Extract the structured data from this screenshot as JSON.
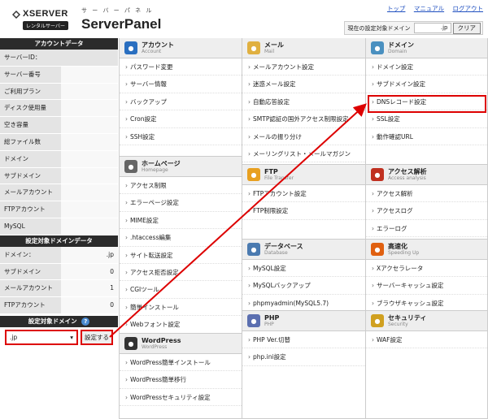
{
  "header": {
    "logo_text": "XSERVER",
    "logo_sub": "レンタルサーバー",
    "title_kana": "サ ー バ ー パ ネ ル",
    "title": "ServerPanel",
    "links": [
      "トップ",
      "マニュアル",
      "ログアウト"
    ],
    "domain_label": "現在の設定対象ドメイン",
    "domain_value": ".jp",
    "clear_label": "クリア"
  },
  "left": {
    "account_head": "アカウントデータ",
    "server_id": "サーバーID：",
    "account_rows": [
      "サーバー番号",
      "ご利用プラン",
      "ディスク使用量",
      "空き容量",
      "総ファイル数",
      "ドメイン",
      "サブドメイン",
      "メールアカウント",
      "FTPアカウント",
      "MySQL"
    ],
    "domain_head": "設定対象ドメインデータ",
    "domain_rows": [
      {
        "k": "ドメイン：",
        "v": ".jp"
      },
      {
        "k": "サブドメイン",
        "v": "0"
      },
      {
        "k": "メールアカウント",
        "v": "1"
      },
      {
        "k": "FTPアカウント",
        "v": "0"
      }
    ],
    "select_head": "設定対象ドメイン",
    "select_value": ".jp",
    "set_button": "設定する"
  },
  "columns": [
    [
      {
        "title": "アカウント",
        "sub": "Account",
        "color": "#2a6fc0",
        "icon": "person-icon",
        "items": [
          "パスワード変更",
          "サーバー情報",
          "バックアップ",
          "Cron設定",
          "SSH設定"
        ],
        "h": 146
      },
      {
        "title": "ホームページ",
        "sub": "Homepage",
        "color": "#666",
        "icon": "home-icon",
        "items": [
          "アクセス制限",
          "エラーページ設定",
          "MIME設定",
          ".htaccess編集",
          "サイト転送設定",
          "アクセス拒否設定",
          "CGIツール",
          "簡単インストール",
          "Webフォント設定"
        ],
        "h": 218
      },
      {
        "title": "WordPress",
        "sub": "WordPress",
        "color": "#333",
        "icon": "wordpress-icon",
        "items": [
          "WordPress簡単インストール",
          "WordPress簡単移行",
          "WordPressセキュリティ設定"
        ],
        "h": 105
      }
    ],
    [
      {
        "title": "メール",
        "sub": "Mail",
        "color": "#e0b040",
        "icon": "mail-icon",
        "items": [
          "メールアカウント設定",
          "迷惑メール設定",
          "自動応答設定",
          "SMTP認証の国外アクセス制限設定",
          "メールの振り分け",
          "メーリングリスト・メールマガジン"
        ],
        "h": 156
      },
      {
        "title": "FTP",
        "sub": "File Transfer",
        "color": "#e8a020",
        "icon": "folder-icon",
        "items": [
          "FTPアカウント設定",
          "FTP制限設定"
        ],
        "h": 92
      },
      {
        "title": "データベース",
        "sub": "Database",
        "color": "#4a7ab0",
        "icon": "database-icon",
        "items": [
          "MySQL設定",
          "MySQLバックアップ",
          "phpmyadmin(MySQL5.7)"
        ],
        "h": 88
      },
      {
        "title": "PHP",
        "sub": "PHP",
        "color": "#5b6fb0",
        "icon": "php-icon",
        "items": [
          "PHP Ver.切替",
          "php.ini設定"
        ],
        "h": 133
      }
    ],
    [
      {
        "title": "ドメイン",
        "sub": "Domain",
        "color": "#4a90c0",
        "icon": "globe-icon",
        "items": [
          "ドメイン設定",
          "サブドメイン設定",
          "DNSレコード設定",
          "SSL設定",
          "動作確認URL"
        ],
        "h": 156
      },
      {
        "title": "アクセス解析",
        "sub": "Access analysis",
        "color": "#c03020",
        "icon": "chart-icon",
        "items": [
          "アクセス解析",
          "アクセスログ",
          "エラーログ"
        ],
        "h": 92
      },
      {
        "title": "高速化",
        "sub": "Speeding Up",
        "color": "#e06010",
        "icon": "speed-icon",
        "items": [
          "Xアクセラレータ",
          "サーバーキャッシュ設定",
          "ブラウザキャッシュ設定"
        ],
        "h": 88
      },
      {
        "title": "セキュリティ",
        "sub": "Security",
        "color": "#d0a020",
        "icon": "lock-icon",
        "items": [
          "WAF設定"
        ],
        "h": 133
      }
    ]
  ]
}
